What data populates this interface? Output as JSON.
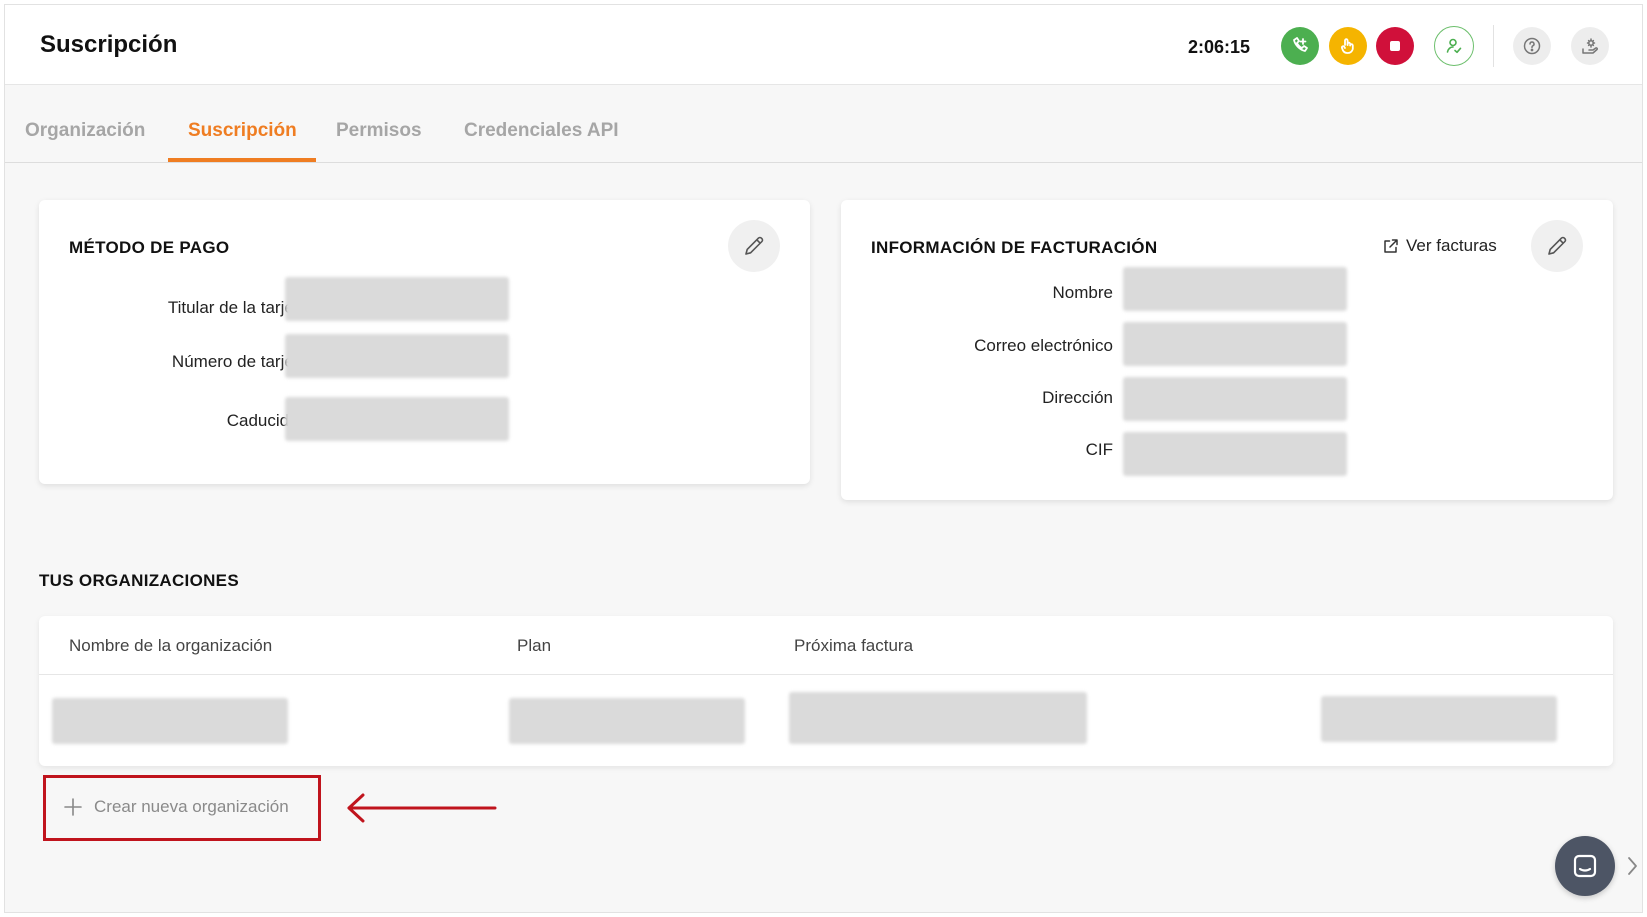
{
  "header": {
    "title": "Suscripción",
    "timer": "2:06:15",
    "icons": [
      "dial-icon",
      "hand-icon",
      "stop-icon",
      "user-icon",
      "help-icon",
      "settings-icon"
    ]
  },
  "tabs": [
    {
      "label": "Organización",
      "active": false
    },
    {
      "label": "Suscripción",
      "active": true
    },
    {
      "label": "Permisos",
      "active": false
    },
    {
      "label": "Credenciales API",
      "active": false
    }
  ],
  "payment": {
    "title": "MÉTODO DE PAGO",
    "fields": [
      "Titular de la tarjeta",
      "Número de tarjeta",
      "Caducidad"
    ]
  },
  "billing": {
    "title": "INFORMACIÓN DE FACTURACIÓN",
    "view_invoices": "Ver facturas",
    "fields": [
      "Nombre",
      "Correo electrónico",
      "Dirección",
      "CIF"
    ]
  },
  "organizations": {
    "title": "TUS ORGANIZACIONES",
    "columns": [
      "Nombre de la organización",
      "Plan",
      "Próxima factura"
    ]
  },
  "create_org_label": "Crear nueva organización",
  "colors": {
    "accent": "#ef7d22",
    "green": "#4caf50",
    "yellow": "#f5b400",
    "red": "#d0103a",
    "highlight": "#c0141d"
  }
}
